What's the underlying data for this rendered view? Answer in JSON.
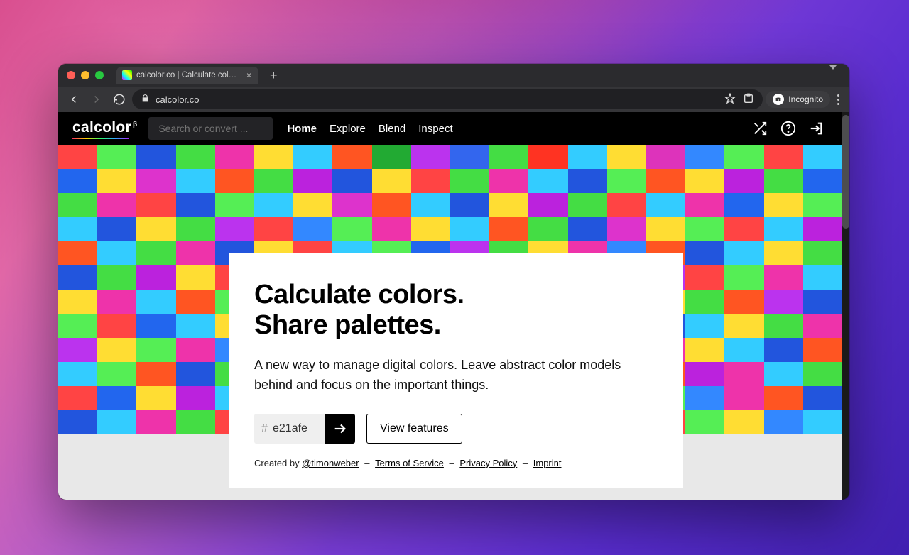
{
  "browser": {
    "tab_title": "calcolor.co | Calculate colors. S",
    "url": "calcolor.co",
    "incognito_label": "Incognito"
  },
  "appbar": {
    "logo_text": "calcolor",
    "logo_badge": "β",
    "search_placeholder": "Search or convert ...",
    "nav": {
      "home": "Home",
      "explore": "Explore",
      "blend": "Blend",
      "inspect": "Inspect"
    }
  },
  "hero": {
    "headline_line1": "Calculate colors.",
    "headline_line2": "Share palettes.",
    "subline": "A new way to manage digital colors. Leave abstract color models behind and focus on the important things.",
    "hex_value": "e21afe",
    "view_features_label": "View features"
  },
  "footer": {
    "created_by": "Created by ",
    "author": "@timonweber",
    "tos": "Terms of Service",
    "privacy": "Privacy Policy",
    "imprint": "Imprint",
    "sep": " – "
  },
  "mosaic_colors": [
    "#ff4444",
    "#55ee55",
    "#2255dd",
    "#44dd44",
    "#ee33aa",
    "#ffdd33",
    "#33ccff",
    "#ff5522",
    "#22aa33",
    "#bb33ee",
    "#3366ee",
    "#44dd44",
    "#ff3322",
    "#33ccff",
    "#ffdd33",
    "#dd33bb",
    "#3388ff",
    "#55ee55",
    "#ff4444",
    "#33ccff",
    "#2266ee",
    "#ffdd33",
    "#dd33cc",
    "#33ccff",
    "#ff5522",
    "#44dd44",
    "#bb22dd",
    "#2255dd",
    "#ffdd33",
    "#ff4444",
    "#44dd44",
    "#ee33aa",
    "#33ccff",
    "#2255dd",
    "#55ee55",
    "#ff5522",
    "#ffdd33",
    "#bb22dd",
    "#44dd44",
    "#2266ee",
    "#44dd44",
    "#ee33aa",
    "#ff4444",
    "#2255dd",
    "#55ee55",
    "#33ccff",
    "#ffdd33",
    "#dd33cc",
    "#ff5522",
    "#33ccff",
    "#2255dd",
    "#ffdd33",
    "#bb22dd",
    "#44dd44",
    "#ff4444",
    "#33ccff",
    "#ee33aa",
    "#2266ee",
    "#ffdd33",
    "#55ee55",
    "#33ccff",
    "#2255dd",
    "#ffdd33",
    "#44dd44",
    "#bb33ee",
    "#ff4444",
    "#3388ff",
    "#55ee55",
    "#ee33aa",
    "#ffdd33",
    "#33ccff",
    "#ff5522",
    "#44dd44",
    "#2255dd",
    "#dd33cc",
    "#ffdd33",
    "#55ee55",
    "#ff4444",
    "#33ccff",
    "#bb22dd",
    "#ff5522",
    "#33ccff",
    "#44dd44",
    "#ee33aa",
    "#2255dd",
    "#ffdd33",
    "#ff4444",
    "#33ccff",
    "#55ee55",
    "#2266ee",
    "#bb33ee",
    "#44dd44",
    "#ffdd33",
    "#ee33aa",
    "#3388ff",
    "#ff5522",
    "#2255dd",
    "#33ccff",
    "#ffdd33",
    "#44dd44",
    "#2255dd",
    "#44dd44",
    "#bb22dd",
    "#ffdd33",
    "#ff4444",
    "#33ccff",
    "#ee33aa",
    "#2266ee",
    "#ffdd33",
    "#55ee55",
    "#ff5522",
    "#33ccff",
    "#2255dd",
    "#44dd44",
    "#ffdd33",
    "#bb33ee",
    "#ff4444",
    "#55ee55",
    "#ee33aa",
    "#33ccff",
    "#ffdd33",
    "#ee33aa",
    "#33ccff",
    "#ff5522",
    "#55ee55",
    "#2255dd",
    "#44dd44",
    "#ffdd33",
    "#bb22dd",
    "#ff4444",
    "#3388ff",
    "#55ee55",
    "#ee33aa",
    "#33ccff",
    "#2266ee",
    "#ffdd33",
    "#44dd44",
    "#ff5522",
    "#bb33ee",
    "#2255dd",
    "#55ee55",
    "#ff4444",
    "#2266ee",
    "#33ccff",
    "#ffdd33",
    "#bb33ee",
    "#ff5522",
    "#44dd44",
    "#2255dd",
    "#ee33aa",
    "#ffdd33",
    "#33ccff",
    "#ff4444",
    "#55ee55",
    "#bb22dd",
    "#2255dd",
    "#33ccff",
    "#ffdd33",
    "#44dd44",
    "#ee33aa",
    "#bb33ee",
    "#ffdd33",
    "#55ee55",
    "#ee33aa",
    "#3388ff",
    "#ff4444",
    "#2255dd",
    "#33ccff",
    "#44dd44",
    "#ff5522",
    "#ffdd33",
    "#2266ee",
    "#55ee55",
    "#bb22dd",
    "#ff4444",
    "#ee33aa",
    "#ffdd33",
    "#33ccff",
    "#2255dd",
    "#ff5522",
    "#33ccff",
    "#55ee55",
    "#ff5522",
    "#2255dd",
    "#44dd44",
    "#ee33aa",
    "#ffdd33",
    "#bb33ee",
    "#33ccff",
    "#2266ee",
    "#44dd44",
    "#ff4444",
    "#ffdd33",
    "#3388ff",
    "#55ee55",
    "#ff5522",
    "#bb22dd",
    "#ee33aa",
    "#33ccff",
    "#44dd44",
    "#ff4444",
    "#2266ee",
    "#ffdd33",
    "#bb22dd",
    "#33ccff",
    "#55ee55",
    "#ff5522",
    "#ee33aa",
    "#ffdd33",
    "#44dd44",
    "#2255dd",
    "#bb33ee",
    "#33ccff",
    "#ff4444",
    "#ffdd33",
    "#55ee55",
    "#3388ff",
    "#ee33aa",
    "#ff5522",
    "#2255dd",
    "#2255dd",
    "#33ccff",
    "#ee33aa",
    "#44dd44",
    "#ff4444",
    "#bb33ee",
    "#2266ee",
    "#55ee55",
    "#ff5522",
    "#33ccff",
    "#ffdd33",
    "#ee33aa",
    "#44dd44",
    "#2255dd",
    "#bb22dd",
    "#ff4444",
    "#55ee55",
    "#ffdd33",
    "#3388ff",
    "#33ccff"
  ]
}
